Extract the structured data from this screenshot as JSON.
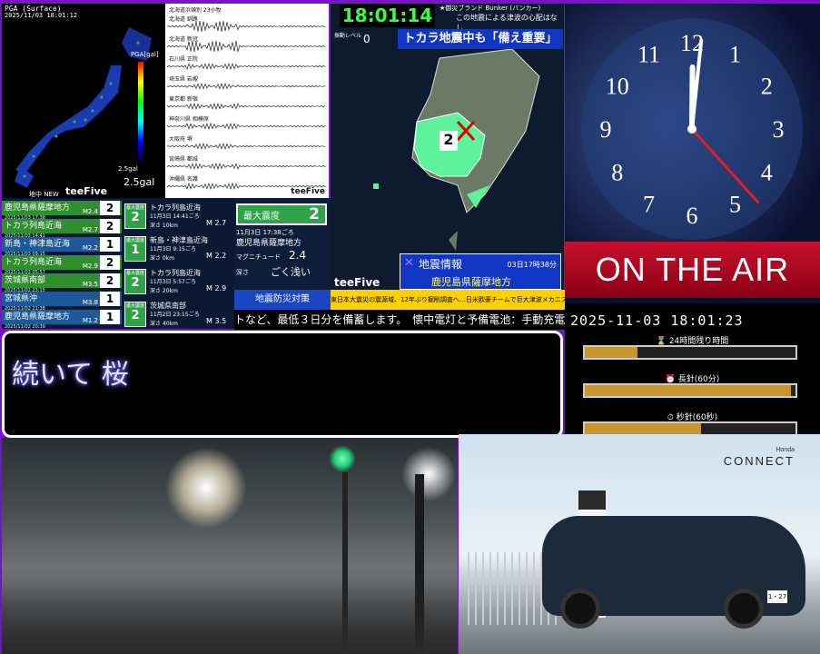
{
  "map_panel": {
    "title": "PGA (Surface)",
    "timestamp": "2025/11/03 18:01:12",
    "scale_label": "PGA[gal]",
    "value_label": "2.5gal",
    "small_value": "2.5gal",
    "credit": "地中 NEW",
    "brand": "teeFive"
  },
  "waveforms": {
    "stations": [
      "北海道 釧路",
      "北海道 新冠",
      "石川県 正院",
      "埼玉県 岩槻",
      "東京都 新宿",
      "神奈川県 相模原",
      "大阪府 堺",
      "宮崎県 都城",
      "沖縄県 名護"
    ],
    "header": "北海道浜頓別 23小牧",
    "brand": "teeFive"
  },
  "quakes": {
    "rows": [
      {
        "name": "鹿児島県薩摩地方",
        "time": "2025/11/03 17:38",
        "mag": "M2.4",
        "level": "2",
        "color": "#2f8f2f"
      },
      {
        "name": "トカラ列島近海",
        "time": "2025/11/03 14:41",
        "mag": "M2.7",
        "level": "2",
        "color": "#2f8f2f"
      },
      {
        "name": "新島・神津島近海",
        "time": "2025/11/03 09:15",
        "mag": "M2.2",
        "level": "1",
        "color": "#1e5a99"
      },
      {
        "name": "トカラ列島近海",
        "time": "2025/11/03 05:57",
        "mag": "M2.9",
        "level": "2",
        "color": "#2f8f2f"
      },
      {
        "name": "茨城県南部",
        "time": "2025/11/02 23:15",
        "mag": "M3.5",
        "level": "2",
        "color": "#2f8f2f"
      },
      {
        "name": "宮城県沖",
        "time": "2025/11/02 21:38",
        "mag": "M3.8",
        "level": "1",
        "color": "#1e5a99"
      },
      {
        "name": "鹿児島県薩摩地方",
        "time": "2025/11/02 20:39",
        "mag": "M1.2",
        "level": "1",
        "color": "#1e5a99"
      }
    ],
    "cards": [
      {
        "label": "最大震度",
        "level": "2",
        "name": "トカラ列島近海",
        "time": "11月3日 14:41ごろ",
        "depth": "深さ 10km",
        "mag": "M 2.7"
      },
      {
        "label": "最大震度",
        "level": "1",
        "name": "新島・神津島近海",
        "time": "11月3日 9:15ごろ",
        "depth": "深さ 0km",
        "mag": "M 2.2"
      },
      {
        "label": "最大震度",
        "level": "2",
        "name": "トカラ列島近海",
        "time": "11月3日 5:57ごろ",
        "depth": "深さ 20km",
        "mag": "M 2.9"
      },
      {
        "label": "最大震度",
        "level": "2",
        "name": "茨城県南部",
        "time": "11月2日 23:15ごろ",
        "depth": "深さ 40km",
        "mag": "M 3.5"
      }
    ]
  },
  "detail": {
    "max_label": "最大震度",
    "max_value": "2",
    "time": "11月3日 17:38ごろ",
    "region": "鹿児島県薩摩地方",
    "mag_label": "マグニチュード",
    "mag_value": "2.4",
    "depth_label": "深さ",
    "depth_value": "ごく浅い"
  },
  "info": {
    "clock": "18:01:14",
    "notice": "★御災ブランド Bunker (バンカー)",
    "tsunami": "この地震による津波の心配はなし",
    "level_label": "振動レベル",
    "level_value": "0",
    "headline": "トカラ地震中も「備え重要」",
    "map_level": "2",
    "eq_label": "地震情報",
    "eq_time": "03日17時38分",
    "eq_region": "鹿児島県薩摩地方",
    "brand": "teeFive"
  },
  "ticker": {
    "label": "地震防災対策",
    "news": "東日本大震災の震源域、12年ぶり掘削調査へ…日米欧豪チームで巨大津波メカニズム解明目指す",
    "scroll": "トなど、最低３日分を備蓄します。　懐中電灯と予備電池：手動充電式の"
  },
  "clock_panel": {
    "numerals": [
      "12",
      "1",
      "2",
      "3",
      "4",
      "5",
      "6",
      "7",
      "8",
      "9",
      "10",
      "11"
    ],
    "on_air": "ON THE AIR",
    "hour_angle": 0.5,
    "minute_angle": 6,
    "second_angle": 138
  },
  "timer": {
    "datetime": "2025-11-03 18:01:23",
    "bars": [
      {
        "label": "24時間残り時間",
        "icon": "hourglass-icon",
        "fraction": 0.25
      },
      {
        "label": "長針(60分)",
        "icon": "clock-icon",
        "fraction": 0.98
      },
      {
        "label": "秒針(60秒)",
        "icon": "stopwatch-icon",
        "fraction": 0.55
      }
    ]
  },
  "subtitle": {
    "text": "続いて 桜"
  },
  "ad": {
    "brand_top": "Honda",
    "brand": "CONNECT",
    "plate": "1・27"
  }
}
